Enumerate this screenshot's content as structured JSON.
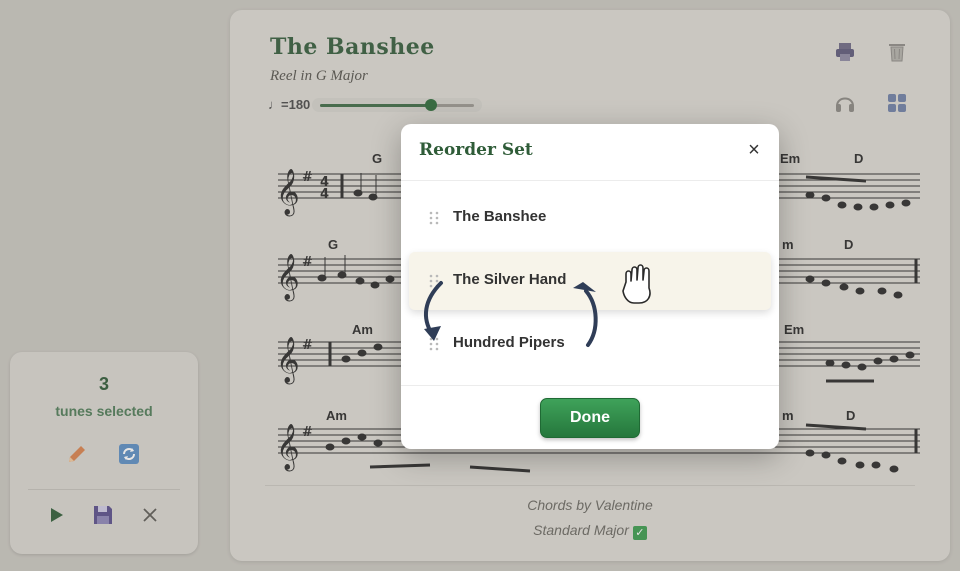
{
  "tune": {
    "title": "The Banshee",
    "subtitle": "Reel in G Major",
    "tempo_label": "♩=180",
    "tempo_fraction": 0.72,
    "chords_credit": "Chords by Valentine",
    "key_mode": "Standard Major",
    "check_glyph": "✓"
  },
  "chords": {
    "line1": [
      "G",
      "Em",
      "D"
    ],
    "line2": [
      "G",
      "m",
      "D"
    ],
    "line3": [
      "Am",
      "Em"
    ],
    "line4": [
      "Am",
      "m",
      "D"
    ]
  },
  "toolbar": {
    "icons": [
      "printer-icon",
      "trash-icon",
      "headphones-icon",
      "grid-icon"
    ]
  },
  "selection": {
    "count": "3",
    "label": "tunes selected",
    "icons": [
      "pencil-icon",
      "refresh-icon",
      "play-icon",
      "save-icon",
      "close-icon"
    ]
  },
  "modal": {
    "title": "Reorder Set",
    "close_glyph": "×",
    "items": [
      {
        "label": "The Banshee"
      },
      {
        "label": "The Silver Hand"
      },
      {
        "label": "Hundred Pipers"
      }
    ],
    "done_label": "Done"
  },
  "colors": {
    "brand_green": "#2f5c38",
    "done_green": "#2f8a47",
    "highlight_row": "#f7f4ea",
    "arrow_navy": "#2f3d57"
  }
}
